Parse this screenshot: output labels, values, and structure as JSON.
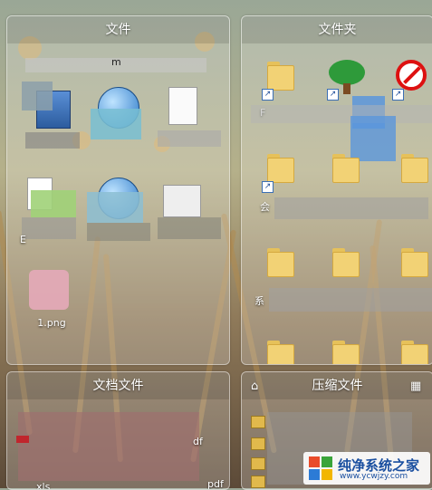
{
  "panels": {
    "files": {
      "title": "文件"
    },
    "folders": {
      "title": "文件夹"
    },
    "documents": {
      "title": "文档文件"
    },
    "archives": {
      "title": "压缩文件"
    }
  },
  "files_items": [
    {
      "label": "m"
    },
    {
      "label": "1.png"
    },
    {
      "label": "E"
    }
  ],
  "folders_items": [
    {
      "label": "F"
    },
    {
      "label": "会"
    },
    {
      "label": "系"
    }
  ],
  "documents_items": [
    {
      "label": "df"
    },
    {
      "label": "pdf"
    },
    {
      "label": "xls"
    }
  ],
  "watermark": {
    "text": "纯净系统之家",
    "sub": "www.ycwjzy.com"
  },
  "icons": {
    "lock": "lock-icon",
    "grid": "grid-icon"
  }
}
